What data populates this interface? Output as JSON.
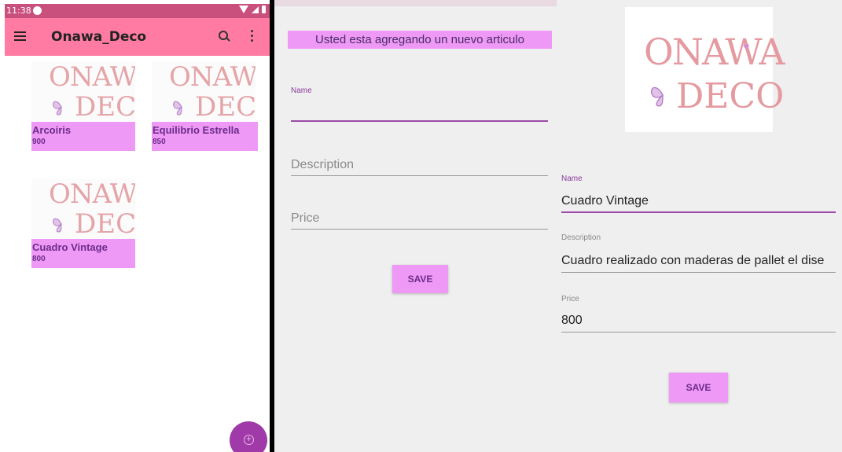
{
  "list_screen": {
    "status_bar": {
      "time": "11:38"
    },
    "app_bar": {
      "title": "Onawa_Deco"
    },
    "products": [
      {
        "name": "Arcoiris",
        "price": "900"
      },
      {
        "name": "Equilibrio Estrella",
        "price": "850"
      },
      {
        "name": "Cuadro Vintage",
        "price": "800"
      }
    ],
    "logo": {
      "line1": "ONAWA",
      "line2": "DECO"
    },
    "fab_icon": "add-circle-icon"
  },
  "add_screen": {
    "banner": "Usted esta agregando un nuevo articulo",
    "name_label": "Name",
    "description_placeholder": "Description",
    "price_placeholder": "Price",
    "save_label": "SAVE"
  },
  "edit_screen": {
    "logo": {
      "line1": "ONAWA",
      "line2": "DECO",
      "heart": "♥"
    },
    "name_label": "Name",
    "name_value": "Cuadro Vintage",
    "description_label": "Description",
    "description_value": "Cuadro realizado con maderas de pallet el dise",
    "price_label": "Price",
    "price_value": "800",
    "save_label": "SAVE"
  },
  "colors": {
    "status_bar": "#c94f7c",
    "app_bar": "#ff7ba3",
    "accent_pink": "#ee99f6",
    "accent_purple": "#9c4ba8",
    "logo_rose": "#e4a4a8"
  }
}
